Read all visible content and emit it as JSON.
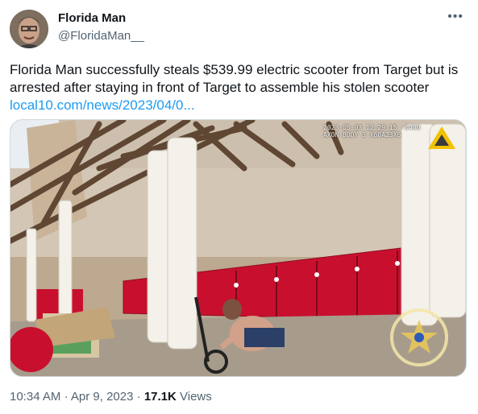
{
  "author": {
    "name": "Florida Man",
    "handle": "@FloridaMan__"
  },
  "tweet": {
    "text": "Florida Man successfully steals $539.99 electric scooter from Target but is arrested after staying in front of Target to assemble his stolen scooter",
    "link": "local10.com/news/2023/04/0..."
  },
  "media": {
    "cam_line1": "2023-05-03 12:29:15 -0400",
    "cam_line2": "AXON BODY 3 X60A23X6",
    "badge_top": "FLAGLER",
    "badge_county": "COUNTY",
    "badge_bottom": "SHERIFF'S OFFICE"
  },
  "footer": {
    "time": "10:34 AM",
    "date": "Apr 9, 2023",
    "views_count": "17.1K",
    "views_label": "Views"
  },
  "icons": {
    "more": "more-dots-icon",
    "axon": "axon-triangle-icon",
    "badge": "sheriff-star-icon"
  }
}
